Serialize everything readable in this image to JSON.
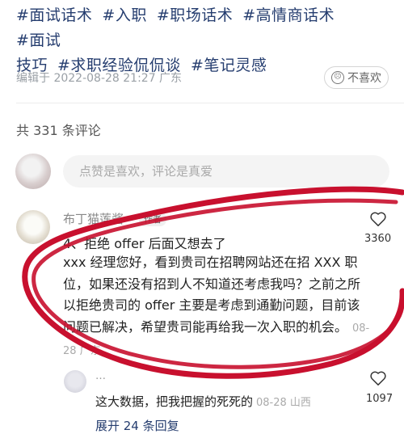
{
  "tags": [
    "#面试话术",
    "#入职",
    "#职场话术",
    "#高情商话术",
    "#面试",
    "技巧",
    "#求职经验侃侃谈",
    "#笔记灵感"
  ],
  "meta": {
    "edited": "编辑于 2022-08-28 21:27 广东"
  },
  "dislike_label": "不喜欢",
  "comment_count_label": "共 331 条评论",
  "comment_input": {
    "placeholder": "点赞是喜欢，评论是真爱"
  },
  "comment": {
    "author_name": "布丁猫莲酱",
    "author_badge": "作者",
    "title": "4、拒绝 offer 后面又想去了",
    "body": "xxx 经理您好，看到贵司在招聘网站还在招 XXX 职位，如果还没有招到人不知道还考虑我吗？之前之所以拒绝贵司的 offer 主要是考虑到通勤问题，目前该问题已解决，希望贵司能再给我一次入职的机会。",
    "date": "08-28 广东",
    "likes": "3360"
  },
  "reply": {
    "name": "…",
    "body": "这大数据，把我把握的死死的",
    "date": "08-28 山西",
    "likes": "1097"
  },
  "expand_label": "展开 24 条回复",
  "colors": {
    "tag_blue": "#253d6f",
    "highlight_red": "#c8102e"
  }
}
